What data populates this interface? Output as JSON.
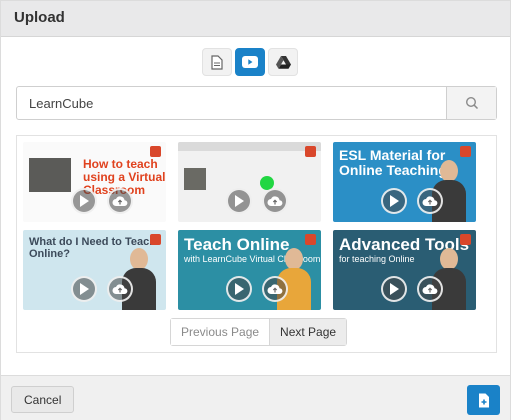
{
  "dialog": {
    "title": "Upload"
  },
  "source_tabs": [
    {
      "icon": "document-icon",
      "active": false
    },
    {
      "icon": "youtube-icon",
      "active": true
    },
    {
      "icon": "google-drive-icon",
      "active": false
    }
  ],
  "search": {
    "value": "LearnCube",
    "button_icon": "search-icon"
  },
  "videos": [
    {
      "caption": "How to teach using a Virtual Classroom"
    },
    {
      "caption": ""
    },
    {
      "caption": "ESL Material for Online Teaching"
    },
    {
      "caption": "What do I Need to Teach Online?"
    },
    {
      "caption": "Teach Online",
      "sub": "with LearnCube Virtual Classroom"
    },
    {
      "caption": "Advanced Tools",
      "sub": "for teaching Online"
    }
  ],
  "video_controls": {
    "play_icon": "play-icon",
    "download_icon": "cloud-upload-icon"
  },
  "pagination": {
    "previous_label": "Previous Page",
    "next_label": "Next Page"
  },
  "footer": {
    "cancel_label": "Cancel",
    "insert_icon": "file-insert-icon"
  },
  "colors": {
    "accent": "#1a82c8",
    "youtube_red": "#ff0000"
  }
}
